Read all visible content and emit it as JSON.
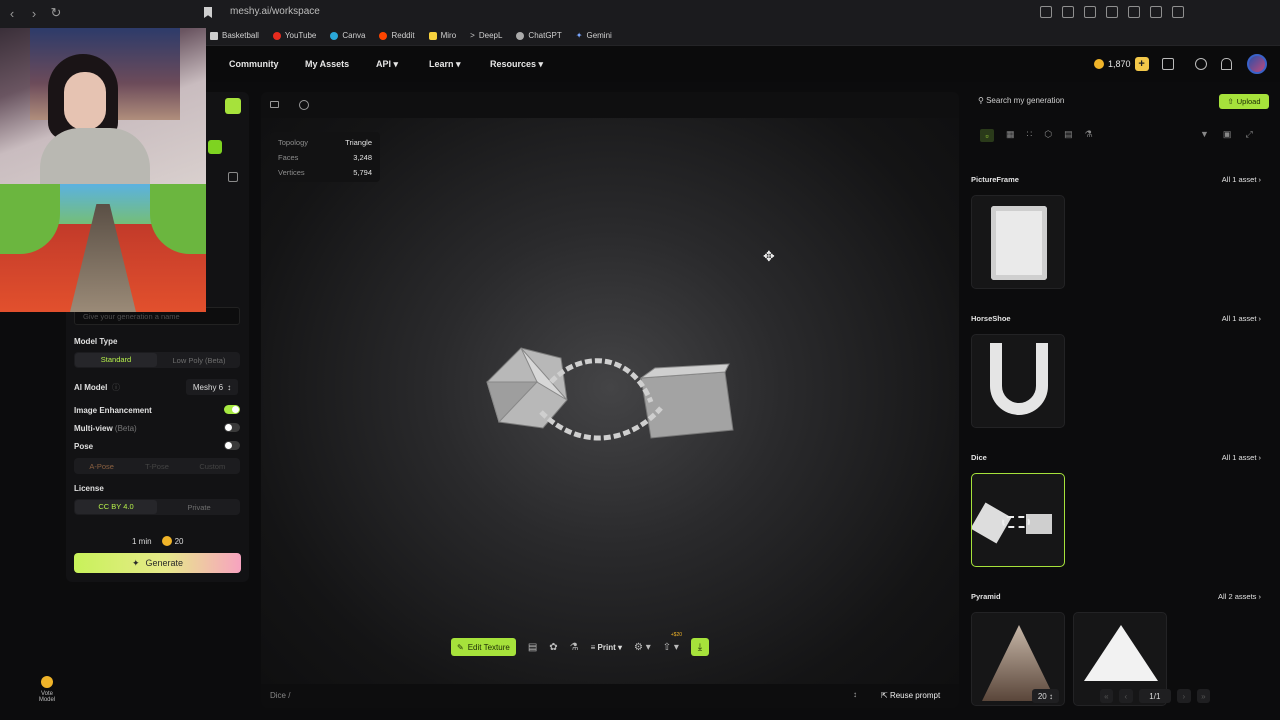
{
  "browser": {
    "url": "meshy.ai/workspace",
    "bookmarks": [
      "Basketball",
      "YouTube",
      "Canva",
      "Reddit",
      "Miro",
      "DeepL",
      "ChatGPT",
      "Gemini"
    ]
  },
  "nav": {
    "items": [
      "Community",
      "My Assets",
      "API",
      "Learn",
      "Resources"
    ],
    "credits": "1,870"
  },
  "left": {
    "name_placeholder": "Give your generation a name",
    "model_type_label": "Model Type",
    "model_type_options": [
      "Standard",
      "Low Poly (Beta)"
    ],
    "ai_model_label": "AI Model",
    "ai_model_value": "Meshy 6",
    "image_enhancement_label": "Image Enhancement",
    "multiview_label": "Multi-view",
    "multiview_beta": "(Beta)",
    "pose_label": "Pose",
    "pose_options": [
      "A-Pose",
      "T-Pose",
      "Custom"
    ],
    "license_label": "License",
    "license_options": [
      "CC BY 4.0",
      "Private"
    ],
    "time": "1 min",
    "cost": "20",
    "generate": "Generate",
    "vote_label": "Vote Model"
  },
  "viewport": {
    "stats": {
      "topology_k": "Topology",
      "topology_v": "Triangle",
      "faces_k": "Faces",
      "faces_v": "3,248",
      "vertices_k": "Vertices",
      "vertices_v": "5,794"
    },
    "edit_texture": "Edit Texture",
    "print": "Print",
    "badge": "+$20",
    "breadcrumb": "Dice",
    "reuse": "Reuse prompt"
  },
  "right": {
    "search_placeholder": "Search my generation",
    "upload": "Upload",
    "sections": [
      {
        "title": "PictureFrame",
        "all": "All 1 asset"
      },
      {
        "title": "HorseShoe",
        "all": "All 1 asset"
      },
      {
        "title": "Dice",
        "all": "All 1 asset"
      },
      {
        "title": "Pyramid",
        "all": "All 2 assets"
      }
    ],
    "page_size": "20",
    "page": "1/1"
  },
  "colors": {
    "accent": "#a6e23b",
    "gold": "#f0b429"
  }
}
